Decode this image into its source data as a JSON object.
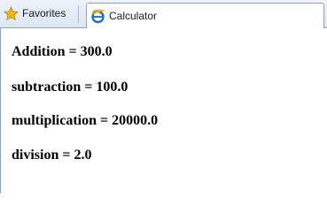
{
  "tabbar": {
    "favorites": {
      "label": "Favorites",
      "icon": "star-icon"
    },
    "active_tab": {
      "title": "Calculator",
      "icon": "ie-icon"
    }
  },
  "page": {
    "results": [
      {
        "label": "Addition",
        "value": "300.0",
        "text": "Addition = 300.0"
      },
      {
        "label": "subtraction",
        "value": "100.0",
        "text": "subtraction = 100.0"
      },
      {
        "label": "multiplication",
        "value": "20000.0",
        "text": "multiplication = 20000.0"
      },
      {
        "label": "division",
        "value": "2.0",
        "text": "division = 2.0"
      }
    ]
  },
  "colors": {
    "tabbar_top": "#eef3fa",
    "tabbar_bottom": "#dbe6f4",
    "border": "#8da2bf",
    "star": "#f2b620",
    "ie_blue": "#1e6fd0"
  }
}
